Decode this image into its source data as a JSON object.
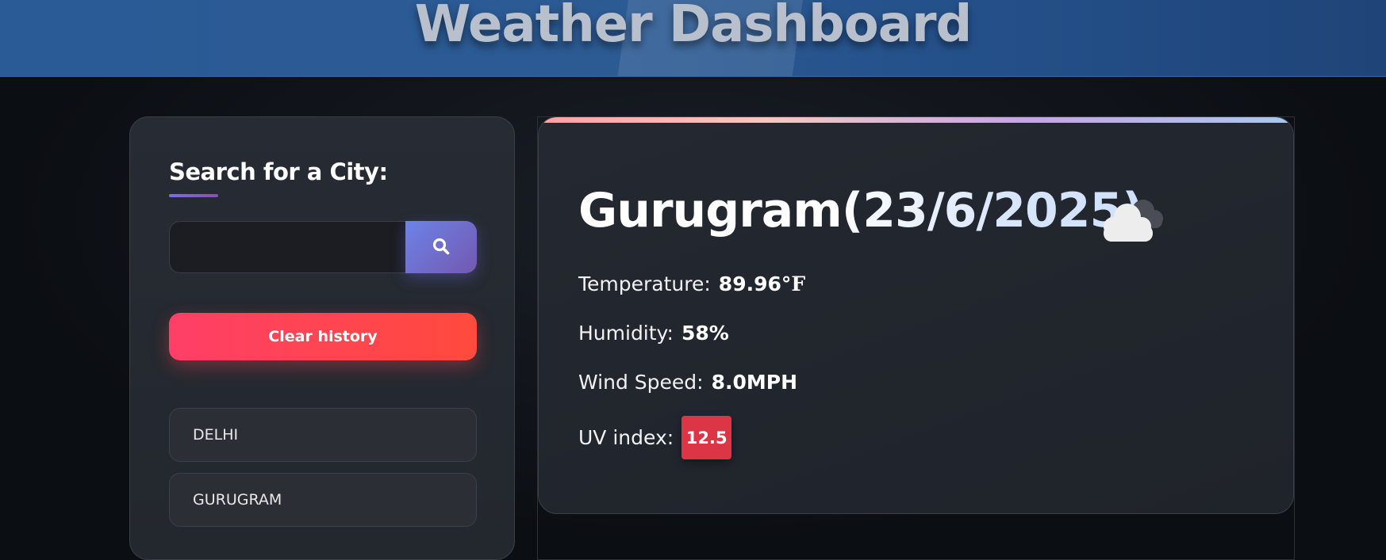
{
  "header": {
    "title": "Weather Dashboard"
  },
  "sidebar": {
    "search_title": "Search for a City:",
    "search_placeholder": "",
    "search_value": "",
    "search_icon": "search-icon",
    "clear_label": "Clear history",
    "history": [
      "DELHI",
      "GURUGRAM"
    ]
  },
  "current": {
    "title": "Gurugram(23/6/2025)",
    "icon": "cloud-icon",
    "temperature_label": "Temperature:",
    "temperature_value": "89.96",
    "temperature_unit": "°F",
    "humidity_label": "Humidity:",
    "humidity_value": "58%",
    "wind_label": "Wind Speed:",
    "wind_value": "8.0MPH",
    "uv_label": "UV index:",
    "uv_value": "12.5"
  },
  "colors": {
    "header_bg": "#2a5b96",
    "accent_search": "#6c83e8",
    "clear_button": "#ff3f67",
    "uv_badge": "#dc3545"
  }
}
